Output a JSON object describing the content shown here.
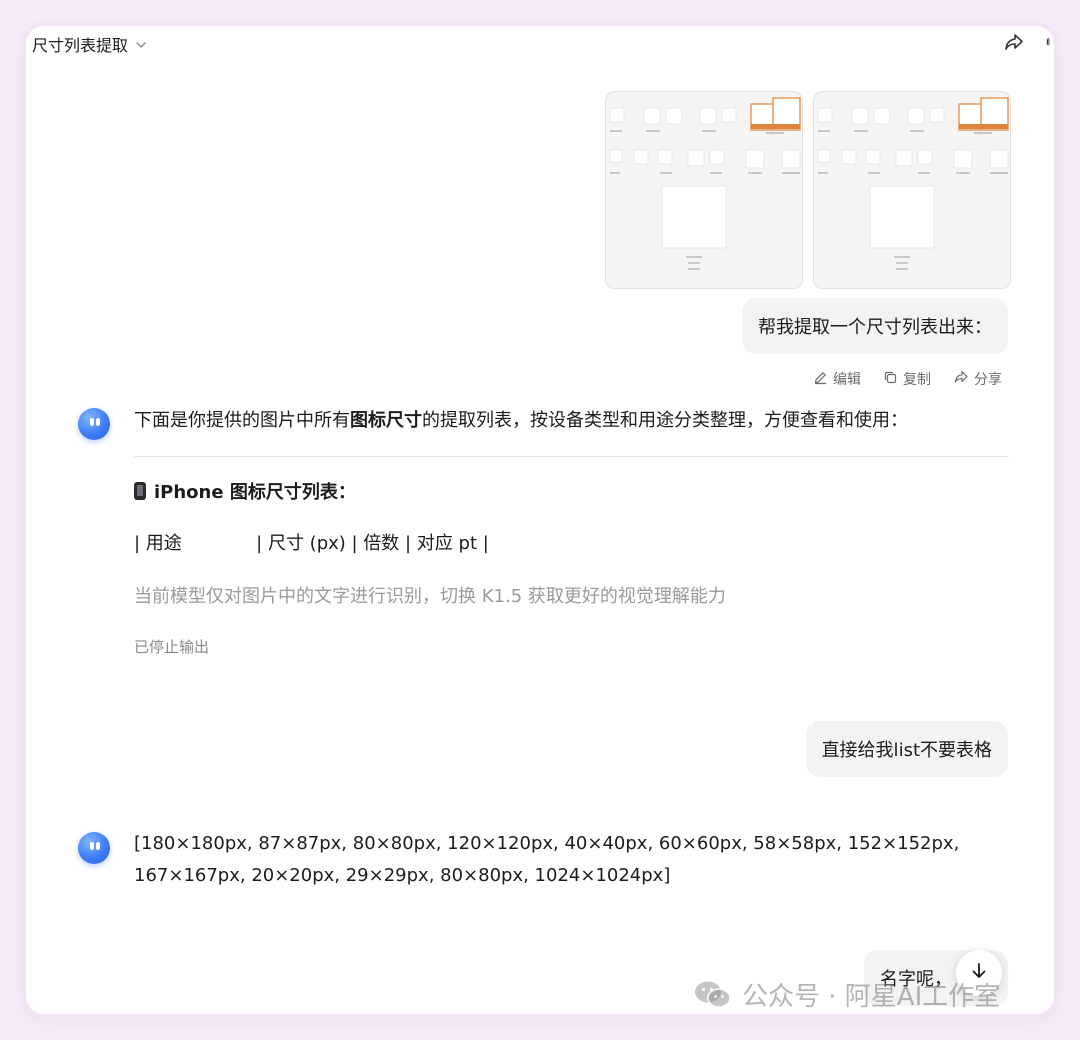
{
  "header": {
    "title": "尺寸列表提取"
  },
  "icons": {
    "share": "share-arrow-icon",
    "attach": "paperclip-icon",
    "edit": "pencil-icon",
    "copy": "copy-icon",
    "scroll_down": "arrow-down-icon",
    "wechat": "wechat-logo-icon"
  },
  "conversation": {
    "user_message_1": "帮我提取一个尺寸列表出来：",
    "actions": {
      "edit": "编辑",
      "copy": "复制",
      "share": "分享"
    },
    "ai_reply_1": {
      "intro_before": "下面是你提供的图片中所有",
      "intro_bold": "图标尺寸",
      "intro_after": "的提取列表，按设备类型和用途分类整理，方便查看和使用：",
      "heading": "iPhone 图标尺寸列表：",
      "table_line": "| 用途             | 尺寸 (px) | 倍数 | 对应 pt |",
      "notice": "当前模型仅对图片中的文字进行识别，切换 K1.5 获取更好的视觉理解能力",
      "status": "已停止输出"
    },
    "user_message_2": "直接给我list不要表格",
    "ai_reply_2": {
      "line1": "[180×180px, 87×87px, 80×80px, 120×120px, 40×40px, 60×60px, 58×58px, 152×152px,",
      "line2": "167×167px, 20×20px, 29×29px, 80×80px, 1024×1024px]"
    },
    "user_message_3": "名字呢，"
  },
  "watermark": {
    "text": "公众号 · 阿星AI工作室"
  },
  "colors": {
    "page_bg": "#f6ecf8",
    "bubble_bg": "#f3f3f3",
    "avatar_blue": "#3d7df6",
    "thumb_accent": "#e0843b",
    "muted_text": "#9a9a9e"
  }
}
